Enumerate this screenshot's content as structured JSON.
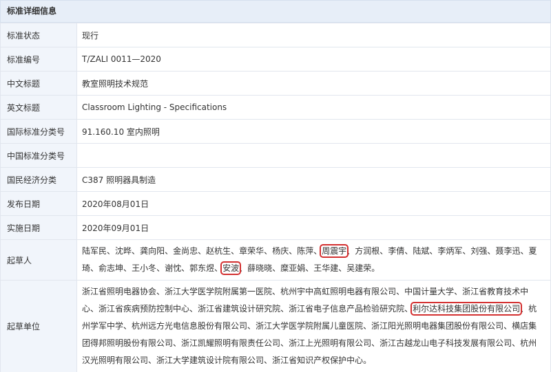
{
  "header": {
    "title": "标准详细信息"
  },
  "rows": [
    {
      "label": "标准状态",
      "value": "现行"
    },
    {
      "label": "标准编号",
      "value": "T/ZALI 0011—2020"
    },
    {
      "label": "中文标题",
      "value": "教室照明技术规范"
    },
    {
      "label": "英文标题",
      "value": "Classroom Lighting - Specifications"
    },
    {
      "label": "国际标准分类号",
      "value": "91.160.10 室内照明"
    },
    {
      "label": "中国标准分类号",
      "value": ""
    },
    {
      "label": "国民经济分类",
      "value": "C387 照明器具制造"
    },
    {
      "label": "发布日期",
      "value": "2020年08月01日"
    },
    {
      "label": "实施日期",
      "value": "2020年09月01日"
    }
  ],
  "drafters": {
    "label": "起草人",
    "names": [
      "陆军民",
      "沈晔",
      "龚向阳",
      "金尚忠",
      "赵杭生",
      "章荣华",
      "杨庆",
      "陈萍",
      "周震宇",
      "方润根",
      "李倩",
      "陆斌",
      "李炳军",
      "刘强",
      "聂李迅",
      "夏琦",
      "俞志坤",
      "王小冬",
      "谢忱",
      "郭东煜",
      "安波",
      "薛晓晓",
      "糜亚娟",
      "王华建",
      "吴建荣"
    ],
    "highlighted": [
      "周震宇",
      "安波"
    ]
  },
  "units": {
    "label": "起草单位",
    "names": [
      "浙江省照明电器协会",
      "浙江大学医学院附属第一医院",
      "杭州宇中高虹照明电器有限公司",
      "中国计量大学",
      "浙江省教育技术中心",
      "浙江省疾病预防控制中心",
      "浙江省建筑设计研究院",
      "浙江省电子信息产品检验研究院",
      "利尔达科技集团股份有限公司",
      "杭州学军中学",
      "杭州远方光电信息股份有限公司",
      "浙江大学医学院附属儿童医院",
      "浙江阳光照明电器集团股份有限公司",
      "横店集团得邦照明股份有限公司",
      "浙江凯耀照明有限责任公司",
      "浙江上光照明有限公司",
      "浙江古越龙山电子科技发展有限公司",
      "杭州汉光照明有限公司",
      "浙江大学建筑设计院有限公司",
      "浙江省知识产权保护中心"
    ],
    "highlighted": [
      "利尔达科技集团股份有限公司"
    ]
  },
  "colors": {
    "header_bg": "#e7eef8",
    "label_bg": "#f1f5fb",
    "border": "#e1e6ee",
    "highlight": "#d32f2f"
  }
}
